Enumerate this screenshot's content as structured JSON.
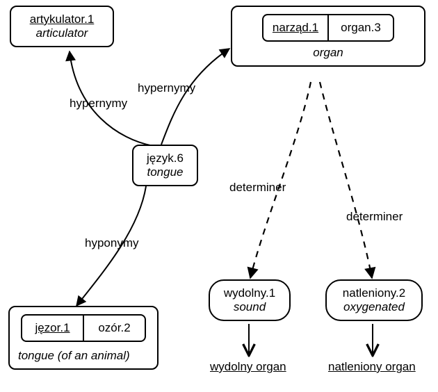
{
  "nodes": {
    "articulator": {
      "head_pl": "artykulator.1",
      "head_en": "articulator"
    },
    "organ": {
      "left_pl": "narząd.1",
      "right": "organ.3",
      "caption_en": "organ"
    },
    "tongue": {
      "head_pl": "język.6",
      "head_en": "tongue"
    },
    "animal_tongue": {
      "left_pl": "jęzor.1",
      "right": "ozór.2",
      "caption_en": "tongue (of an animal)"
    },
    "sound": {
      "head_pl": "wydolny.1",
      "head_en": "sound"
    },
    "oxygenated": {
      "head_pl": "natleniony.2",
      "head_en": "oxygenated"
    }
  },
  "edges": {
    "hypernymy1": "hypernymy",
    "hypernymy2": "hypernymy",
    "hyponymy": "hyponymy",
    "determiner1": "determiner",
    "determiner2": "determiner"
  },
  "phrases": {
    "sound_organ": "wydolny organ",
    "oxygenated_organ": "natleniony organ"
  }
}
